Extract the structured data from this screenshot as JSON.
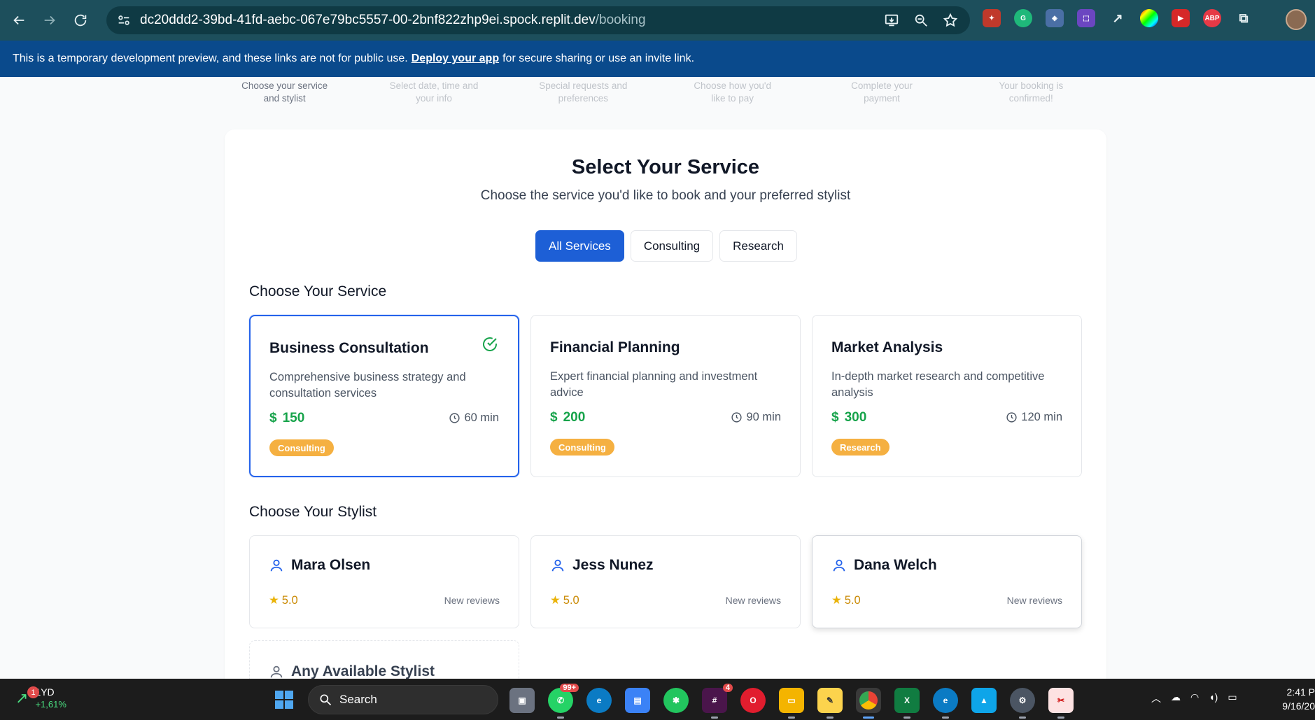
{
  "browser": {
    "url_host": "dc20ddd2-39bd-41fd-aebc-067e79bc5557-00-2bnf822zhp9ei.spock.replit.dev",
    "url_path": "/booking"
  },
  "banner": {
    "text_before": "This is a temporary development preview, and these links are not for public use.",
    "link": "Deploy your app",
    "text_after": "for secure sharing or use an invite link."
  },
  "steps": [
    {
      "line1": "Choose your service",
      "line2": "and stylist"
    },
    {
      "line1": "Select date, time and",
      "line2": "your info"
    },
    {
      "line1": "Special requests and",
      "line2": "preferences"
    },
    {
      "line1": "Choose how you'd",
      "line2": "like to pay"
    },
    {
      "line1": "Complete your",
      "line2": "payment"
    },
    {
      "line1": "Your booking is",
      "line2": "confirmed!"
    }
  ],
  "page": {
    "title": "Select Your Service",
    "subtitle": "Choose the service you'd like to book and your preferred stylist",
    "filters": [
      "All Services",
      "Consulting",
      "Research"
    ],
    "service_section": "Choose Your Service",
    "stylist_section": "Choose Your Stylist"
  },
  "services": [
    {
      "name": "Business Consultation",
      "desc": "Comprehensive business strategy and consultation services",
      "price": "150",
      "duration": "60 min",
      "tag": "Consulting"
    },
    {
      "name": "Financial Planning",
      "desc": "Expert financial planning and investment advice",
      "price": "200",
      "duration": "90 min",
      "tag": "Consulting"
    },
    {
      "name": "Market Analysis",
      "desc": "In-depth market research and competitive analysis",
      "price": "300",
      "duration": "120 min",
      "tag": "Research"
    }
  ],
  "stylists": [
    {
      "name": "Mara Olsen",
      "rating": "5.0",
      "reviews": "New reviews"
    },
    {
      "name": "Jess Nunez",
      "rating": "5.0",
      "reviews": "New reviews"
    },
    {
      "name": "Dana Welch",
      "rating": "5.0",
      "reviews": "New reviews"
    }
  ],
  "any_stylist": "Any Available Stylist",
  "taskbar": {
    "stock_badge": "1",
    "stock_name": "1YD",
    "stock_change": "+1,61%",
    "search": "Search",
    "whatsapp_badge": "99+",
    "slack_badge": "4",
    "time": "2:41 P",
    "date": "9/16/20"
  },
  "colors": {
    "primary": "#1d5fd6",
    "price_green": "#16a34a",
    "tag_orange": "#f5b041",
    "banner_blue": "#0a4a8c"
  }
}
